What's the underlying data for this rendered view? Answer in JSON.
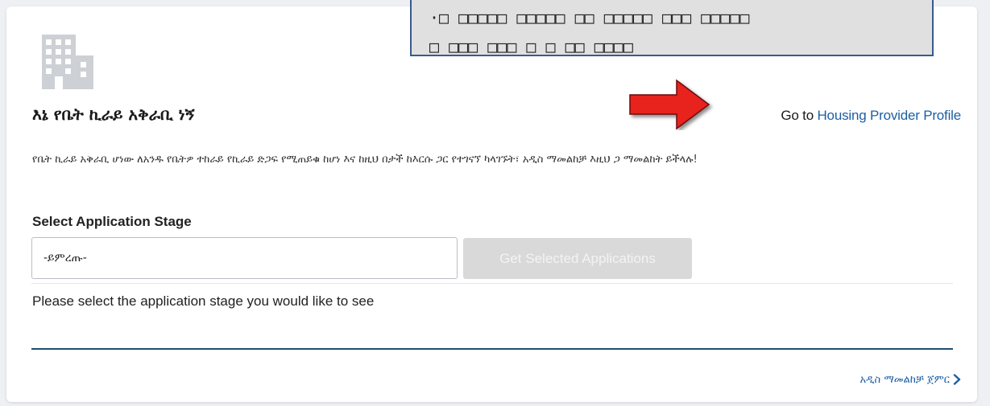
{
  "header": {
    "title": "እኔ የቤት ኪራይ አቅራቢ ነኝ",
    "provider_link_prefix": "Go to ",
    "provider_link_label": "Housing Provider Profile"
  },
  "description": "የቤት ኪራይ አቅራቢ ሆነው ለአንዱ የቤትዎ ተከራይ የኪራይ ድጋፍ የሚጠይቁ ከሆነ እና ከዚህ በታች ከእርሱ ጋር የተገናኘ ካላገኙት፣ አዲስ ማመልከቻ እዚህ ጋ ማመልከት ይችላሉ!",
  "stage_selector": {
    "label": "Select Application Stage",
    "selected_value": "-ይምረጡ-",
    "button_label": "Get Selected Applications",
    "instruction": "Please select the application stage you would like to see"
  },
  "footer": {
    "new_application_label": "አዲስ ማመልከቻ ጀምር"
  },
  "annotation": {
    "line1": "·□ □□□□□ □□□□□ □□ □□□□□ □□□ □□□□□",
    "line2": "□ □□□  □□□ □ □ □□ □□□□"
  },
  "colors": {
    "link": "#1d5fa3",
    "divider": "#1f4e6e",
    "button_disabled": "#d9d9d9",
    "arrow": "#e8231d",
    "icon_gray": "#cdd0d5"
  },
  "icons": {
    "building": "building-icon",
    "arrow": "red-arrow-icon",
    "chevron": "chevron-right-icon"
  }
}
